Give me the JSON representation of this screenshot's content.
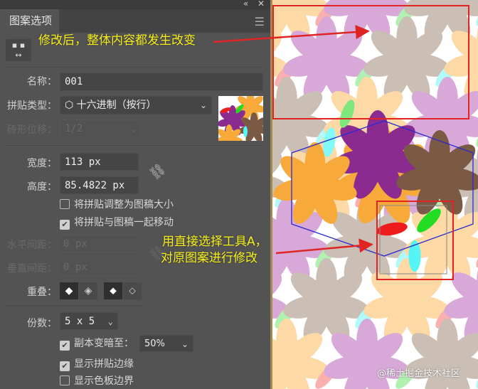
{
  "panel": {
    "title": "图案选项",
    "collapse_icon": "double-chevron-left-icon",
    "close_icon": "close-icon",
    "menu_icon": "hamburger-icon",
    "fit_tile_icon": "fit-tile-to-art-icon",
    "name": {
      "label": "名称：",
      "value": "001"
    },
    "tile_type": {
      "label": "拼贴类型：",
      "value": "⬡ 十六进制（按行）"
    },
    "brick_offset": {
      "label": "砖形位移：",
      "value": "1/2"
    },
    "width": {
      "label": "宽度：",
      "value": "113 px"
    },
    "height": {
      "label": "高度：",
      "value": "85.4822 px"
    },
    "size_tile_to_art": {
      "label": "将拼贴调整为图稿大小",
      "checked": false
    },
    "move_tile_with_art": {
      "label": "将拼贴与图稿一起移动",
      "checked": true
    },
    "h_spacing": {
      "label": "水平间距：",
      "value": "0 px"
    },
    "v_spacing": {
      "label": "垂直间距：",
      "value": "0 px"
    },
    "overlap": {
      "label": "重叠："
    },
    "copies": {
      "label": "份数：",
      "value": "5 x 5"
    },
    "dim_copies": {
      "label": "副本变暗至：",
      "checked": true,
      "value": "50%"
    },
    "show_tile_edge": {
      "label": "显示拼贴边缘",
      "checked": true
    },
    "show_swatch_bounds": {
      "label": "显示色板边界",
      "checked": false
    }
  },
  "annotations": {
    "top": "修改后，整体内容都发生改变",
    "bottom_line1": "用直接选择工具A，",
    "bottom_line2": "对原图案进行修改"
  },
  "watermark": "@稀土掘金技术社区",
  "colors": {
    "accent_red": "#e02424",
    "tile_edge": "#2a2ad0",
    "note": "#f6ef1a"
  }
}
